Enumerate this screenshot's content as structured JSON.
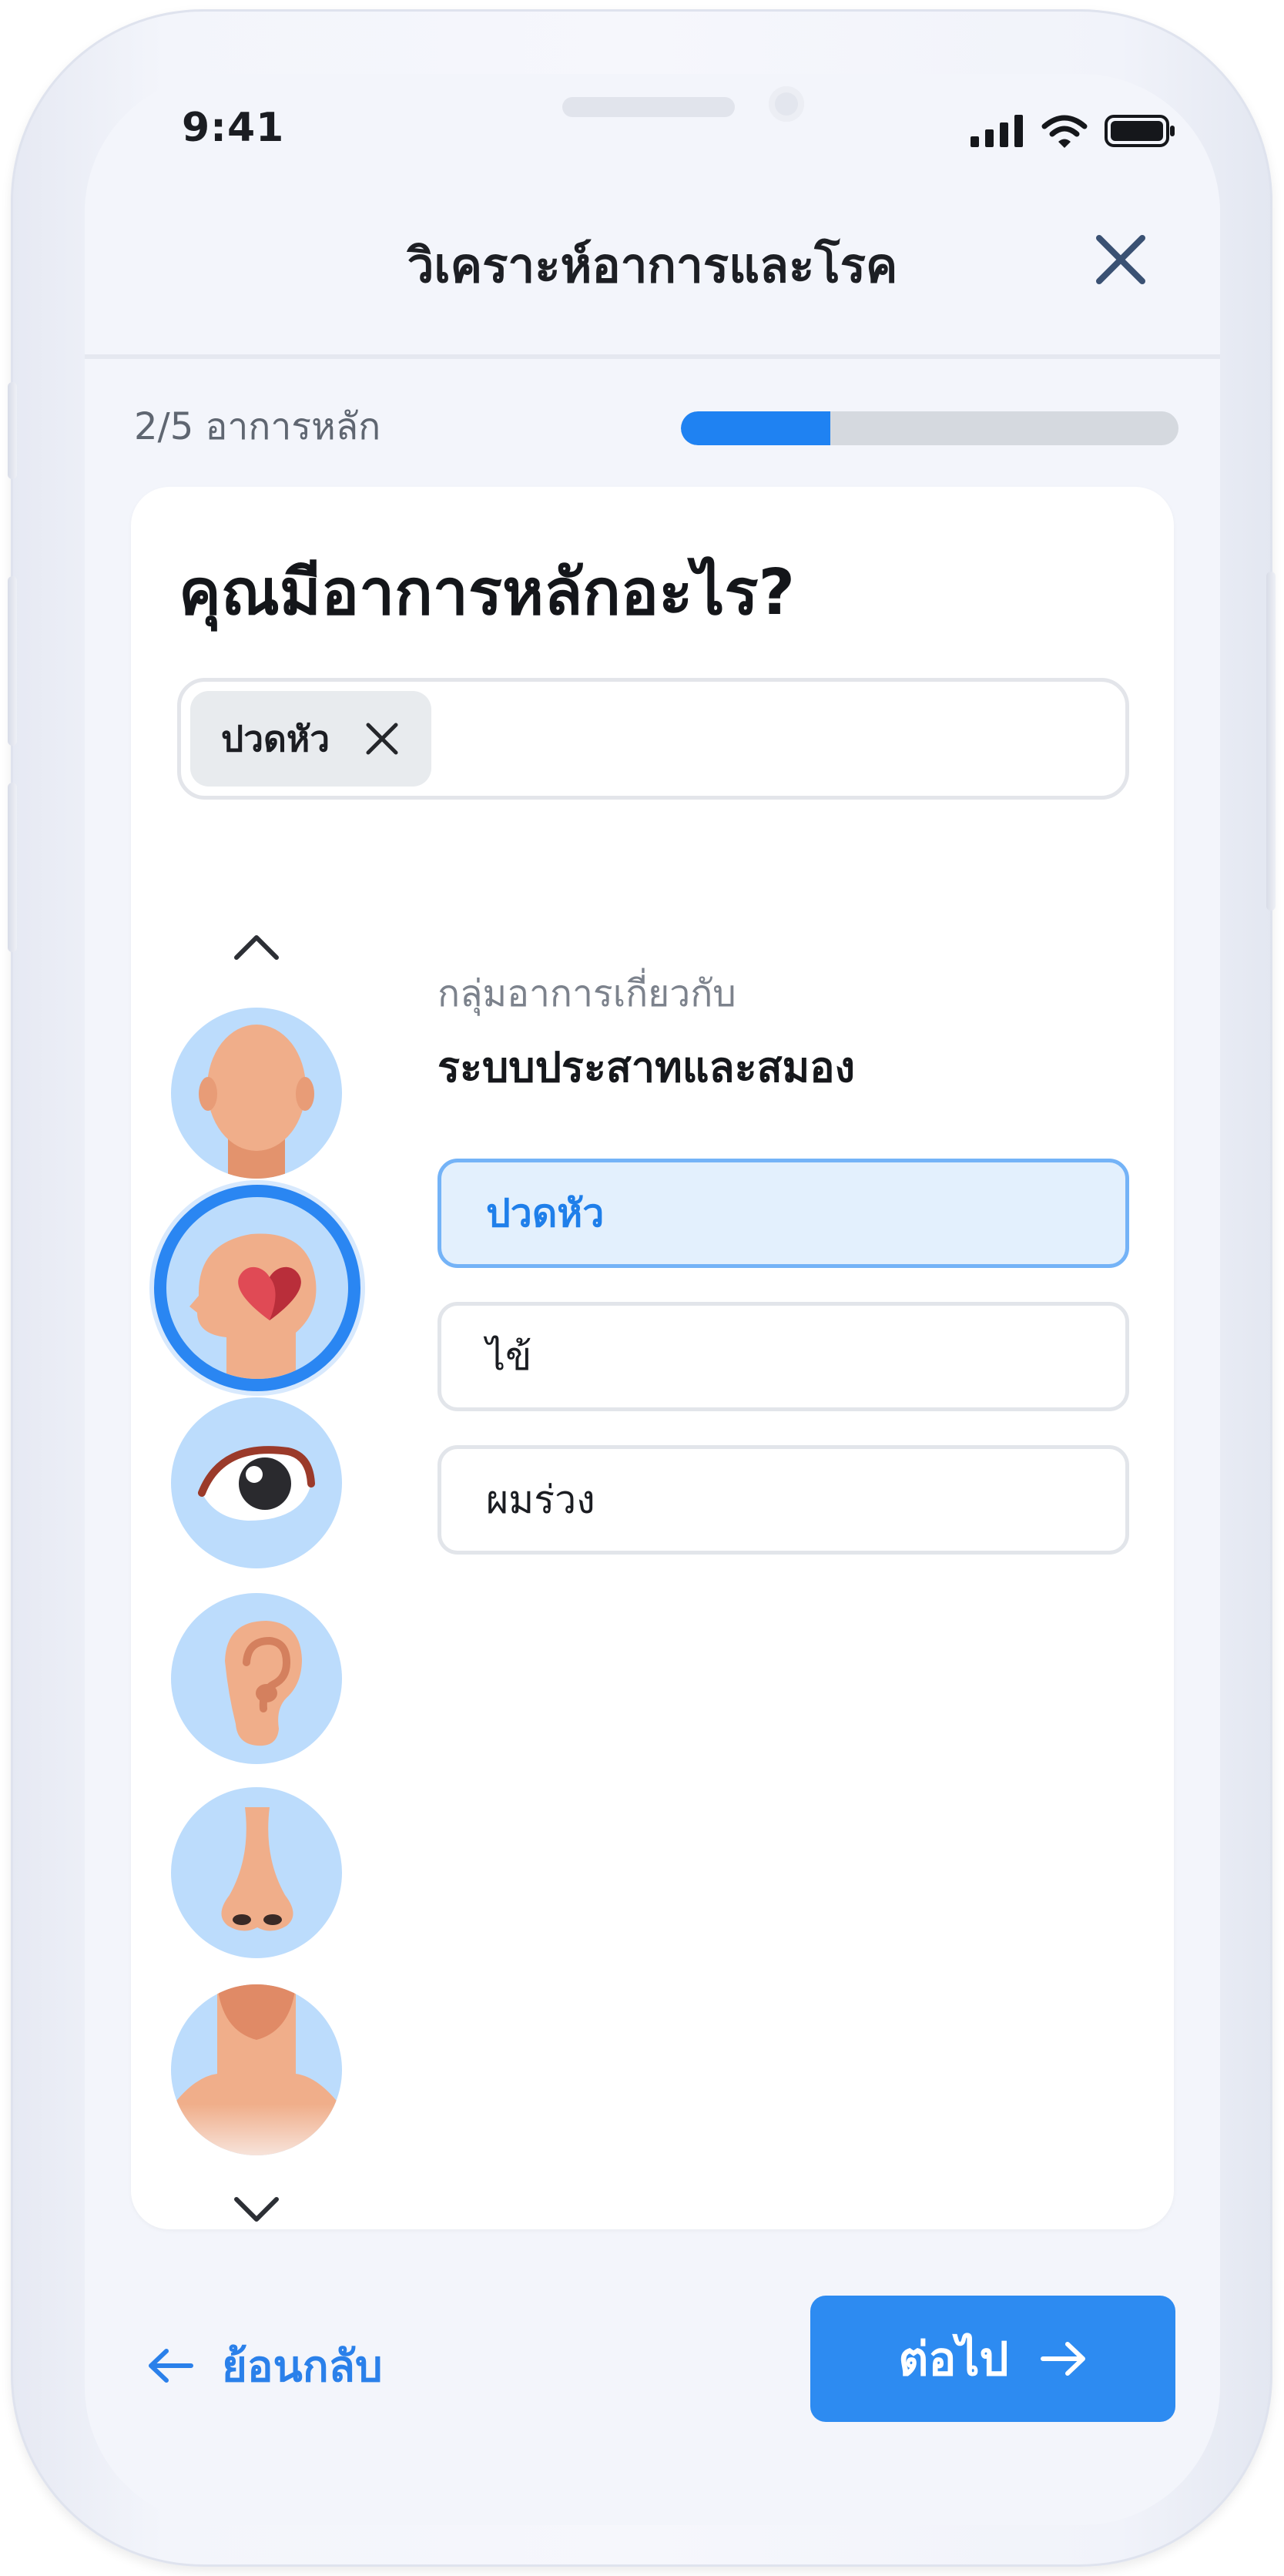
{
  "status_bar": {
    "time": "9:41",
    "icons": [
      "signal-bars-icon",
      "wifi-icon",
      "battery-icon"
    ]
  },
  "header": {
    "title": "วิเคราะห์อาการและโรค",
    "close_icon": "close-icon"
  },
  "progress": {
    "label": "2/5  อาการหลัก",
    "fraction": 0.3
  },
  "card": {
    "question": "คุณมีอาการหลักอะไร?",
    "selected_chips": [
      {
        "label": "ปวดหัว",
        "remove_icon": "close-icon"
      }
    ],
    "body_parts": [
      {
        "name": "head",
        "selected": false
      },
      {
        "name": "brain",
        "selected": true
      },
      {
        "name": "eye",
        "selected": false
      },
      {
        "name": "ear",
        "selected": false
      },
      {
        "name": "nose",
        "selected": false
      },
      {
        "name": "neck",
        "selected": false
      }
    ],
    "group_subtitle": "กลุ่มอาการเกี่ยวกับ",
    "group_title": "ระบบประสาทและสมอง",
    "options": [
      {
        "label": "ปวดหัว",
        "selected": true
      },
      {
        "label": "ไข้",
        "selected": false
      },
      {
        "label": "ผมร่วง",
        "selected": false
      }
    ]
  },
  "footer": {
    "back_label": "ย้อนกลับ",
    "next_label": "ต่อไป"
  },
  "colors": {
    "accent": "#2D8BF1",
    "selected_bg": "#E3F0FD",
    "avatar_bg": "#BCDCFC",
    "screen_bg": "#F3F5FB"
  }
}
